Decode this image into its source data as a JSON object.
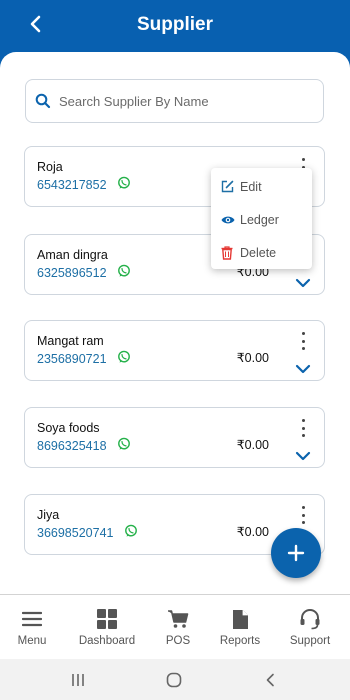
{
  "header": {
    "title": "Supplier",
    "back_icon": "chevron-left-icon"
  },
  "search": {
    "placeholder": "Search Supplier By Name",
    "value": "",
    "icon": "search-icon"
  },
  "suppliers": [
    {
      "name": "Roja",
      "phone": "6543217852",
      "amount": ""
    },
    {
      "name": "Aman dingra",
      "phone": "6325896512",
      "amount": "₹0.00"
    },
    {
      "name": "Mangat ram",
      "phone": "2356890721",
      "amount": "₹0.00"
    },
    {
      "name": "Soya foods",
      "phone": "8696325418",
      "amount": "₹0.00"
    },
    {
      "name": "Jiya",
      "phone": "36698520741",
      "amount": "₹0.00"
    }
  ],
  "context_menu": {
    "items": [
      {
        "label": "Edit",
        "icon": "edit-icon"
      },
      {
        "label": "Ledger",
        "icon": "eye-icon"
      },
      {
        "label": "Delete",
        "icon": "trash-icon"
      }
    ]
  },
  "fab": {
    "icon": "plus-icon"
  },
  "bottom_nav": [
    {
      "label": "Menu",
      "icon": "hamburger-icon"
    },
    {
      "label": "Dashboard",
      "icon": "grid-icon"
    },
    {
      "label": "POS",
      "icon": "cart-icon"
    },
    {
      "label": "Reports",
      "icon": "document-icon"
    },
    {
      "label": "Support",
      "icon": "headset-icon"
    }
  ],
  "system_nav": [
    {
      "icon": "recents-icon"
    },
    {
      "icon": "home-icon"
    },
    {
      "icon": "back-icon"
    }
  ],
  "colors": {
    "primary": "#0860b0",
    "phone": "#1d6fa5",
    "whatsapp": "#25b14a",
    "edit": "#1d6fa5",
    "delete": "#e53935"
  }
}
